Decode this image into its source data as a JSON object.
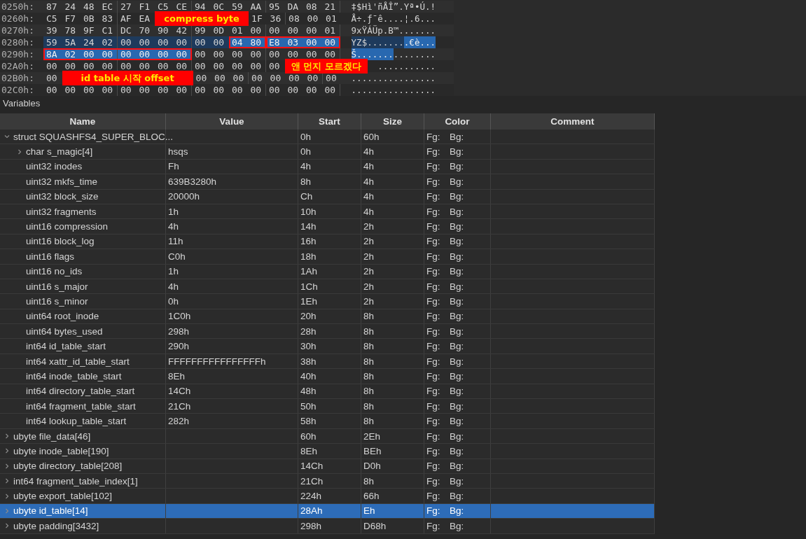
{
  "hex_rows": [
    {
      "address": "0250h:",
      "segments": [
        {
          "kind": "plain",
          "boxed": false,
          "bytes": [
            "87",
            "24",
            "48",
            "EC",
            "27",
            "F1",
            "C5",
            "CE",
            "94",
            "0C",
            "59",
            "AA",
            "95",
            "DA",
            "08",
            "21"
          ]
        }
      ],
      "ascii": [
        {
          "kind": "plain",
          "text": "‡$Hì'ñÅÎ”.Yª•Ú.!"
        }
      ]
    },
    {
      "address": "0260h:",
      "segments": [
        {
          "kind": "plain",
          "boxed": false,
          "bytes": [
            "C5",
            "F7",
            "0B",
            "83",
            "AF",
            "EA"
          ]
        },
        {
          "kind": "callout",
          "text": "compress byte"
        },
        {
          "kind": "plain",
          "boxed": false,
          "bytes": [
            "1F",
            "36",
            "08",
            "00",
            "01"
          ]
        }
      ],
      "ascii": [
        {
          "kind": "plain",
          "text": "Å÷.ƒ¯ê....¦.6..."
        }
      ]
    },
    {
      "address": "0270h:",
      "segments": [
        {
          "kind": "plain",
          "boxed": false,
          "bytes": [
            "39",
            "78",
            "9F",
            "C1",
            "DC",
            "70",
            "90",
            "42",
            "99",
            "0D",
            "01",
            "00",
            "00",
            "00",
            "00",
            "01"
          ]
        }
      ],
      "ascii": [
        {
          "kind": "plain",
          "text": "9xŸÁÜp.B™......."
        }
      ]
    },
    {
      "address": "0280h:",
      "segments": [
        {
          "kind": "dim",
          "boxed": false,
          "bytes": [
            "59",
            "5A",
            "24",
            "02",
            "00",
            "00",
            "00",
            "00",
            "00",
            "00"
          ]
        },
        {
          "kind": "selected",
          "boxed": true,
          "bytes": [
            "04",
            "80"
          ]
        },
        {
          "kind": "selected",
          "boxed": true,
          "bytes": [
            "E8",
            "03",
            "00",
            "00"
          ]
        }
      ],
      "ascii": [
        {
          "kind": "dim",
          "text": "YZ$......."
        },
        {
          "kind": "selected",
          "text": ".€è..."
        }
      ]
    },
    {
      "address": "0290h:",
      "segments": [
        {
          "kind": "selected",
          "boxed": true,
          "bytes": [
            "8A",
            "02",
            "00",
            "00",
            "00",
            "00",
            "00",
            "00"
          ]
        },
        {
          "kind": "plain",
          "boxed": false,
          "bytes": [
            "00",
            "00",
            "00",
            "00",
            "00",
            "00",
            "00",
            "00"
          ]
        }
      ],
      "ascii": [
        {
          "kind": "selected",
          "text": "Š......."
        },
        {
          "kind": "plain",
          "text": "........"
        }
      ]
    },
    {
      "address": "02A0h:",
      "segments": [
        {
          "kind": "plain",
          "boxed": false,
          "bytes": [
            "00",
            "00",
            "00",
            "00",
            "00",
            "00",
            "00",
            "00",
            "00",
            "00",
            "00",
            "00",
            "00"
          ]
        },
        {
          "kind": "callout",
          "text": "앤 먼지 모르겠다"
        }
      ],
      "ascii": [
        {
          "kind": "plain",
          "text": "..........."
        }
      ]
    },
    {
      "address": "02B0h:",
      "segments": [
        {
          "kind": "plain",
          "boxed": false,
          "bytes": [
            "00"
          ]
        },
        {
          "kind": "callout",
          "text": "id table 시작 offset"
        },
        {
          "kind": "plain",
          "boxed": false,
          "bytes": [
            "00",
            "00",
            "00",
            "00",
            "00",
            "00",
            "00",
            "00"
          ]
        }
      ],
      "ascii": [
        {
          "kind": "plain",
          "text": "................"
        }
      ]
    },
    {
      "address": "02C0h:",
      "segments": [
        {
          "kind": "plain",
          "boxed": false,
          "bytes": [
            "00",
            "00",
            "00",
            "00",
            "00",
            "00",
            "00",
            "00",
            "00",
            "00",
            "00",
            "00",
            "00",
            "00",
            "00",
            "00"
          ]
        }
      ],
      "ascii": [
        {
          "kind": "plain",
          "text": "................"
        }
      ]
    }
  ],
  "variables": {
    "title": "Variables",
    "columns": [
      "Name",
      "Value",
      "Start",
      "Size",
      "Color",
      "Comment"
    ],
    "items": [
      {
        "name": "struct SQUASHFS4_SUPER_BLOC...",
        "start": "0h",
        "size": "60h",
        "fg": "Fg:",
        "bg": "Bg:",
        "expanded": true,
        "selected": false,
        "children": [
          {
            "name": "char s_magic[4]",
            "value": "hsqs",
            "start": "0h",
            "size": "4h",
            "fg": "Fg:",
            "bg": "Bg:",
            "expanded": false,
            "selected": false
          },
          {
            "name": "uint32 inodes",
            "value": "Fh",
            "start": "4h",
            "size": "4h",
            "fg": "Fg:",
            "bg": "Bg:",
            "selected": false
          },
          {
            "name": "uint32 mkfs_time",
            "value": "639B3280h",
            "start": "8h",
            "size": "4h",
            "fg": "Fg:",
            "bg": "Bg:",
            "selected": false
          },
          {
            "name": "uint32 block_size",
            "value": "20000h",
            "start": "Ch",
            "size": "4h",
            "fg": "Fg:",
            "bg": "Bg:",
            "selected": false
          },
          {
            "name": "uint32 fragments",
            "value": "1h",
            "start": "10h",
            "size": "4h",
            "fg": "Fg:",
            "bg": "Bg:",
            "selected": false
          },
          {
            "name": "uint16 compression",
            "value": "4h",
            "start": "14h",
            "size": "2h",
            "fg": "Fg:",
            "bg": "Bg:",
            "selected": false
          },
          {
            "name": "uint16 block_log",
            "value": "11h",
            "start": "16h",
            "size": "2h",
            "fg": "Fg:",
            "bg": "Bg:",
            "selected": false
          },
          {
            "name": "uint16 flags",
            "value": "C0h",
            "start": "18h",
            "size": "2h",
            "fg": "Fg:",
            "bg": "Bg:",
            "selected": false
          },
          {
            "name": "uint16 no_ids",
            "value": "1h",
            "start": "1Ah",
            "size": "2h",
            "fg": "Fg:",
            "bg": "Bg:",
            "selected": false
          },
          {
            "name": "uint16 s_major",
            "value": "4h",
            "start": "1Ch",
            "size": "2h",
            "fg": "Fg:",
            "bg": "Bg:",
            "selected": false
          },
          {
            "name": "uint16 s_minor",
            "value": "0h",
            "start": "1Eh",
            "size": "2h",
            "fg": "Fg:",
            "bg": "Bg:",
            "selected": false
          },
          {
            "name": "uint64 root_inode",
            "value": "1C0h",
            "start": "20h",
            "size": "8h",
            "fg": "Fg:",
            "bg": "Bg:",
            "selected": false
          },
          {
            "name": "uint64 bytes_used",
            "value": "298h",
            "start": "28h",
            "size": "8h",
            "fg": "Fg:",
            "bg": "Bg:",
            "selected": false
          },
          {
            "name": "int64 id_table_start",
            "value": "290h",
            "start": "30h",
            "size": "8h",
            "fg": "Fg:",
            "bg": "Bg:",
            "selected": false
          },
          {
            "name": "int64 xattr_id_table_start",
            "value": "FFFFFFFFFFFFFFFFh",
            "start": "38h",
            "size": "8h",
            "fg": "Fg:",
            "bg": "Bg:",
            "selected": false
          },
          {
            "name": "int64 inode_table_start",
            "value": "8Eh",
            "start": "40h",
            "size": "8h",
            "fg": "Fg:",
            "bg": "Bg:",
            "selected": false
          },
          {
            "name": "int64 directory_table_start",
            "value": "14Ch",
            "start": "48h",
            "size": "8h",
            "fg": "Fg:",
            "bg": "Bg:",
            "selected": false
          },
          {
            "name": "int64 fragment_table_start",
            "value": "21Ch",
            "start": "50h",
            "size": "8h",
            "fg": "Fg:",
            "bg": "Bg:",
            "selected": false
          },
          {
            "name": "int64 lookup_table_start",
            "value": "282h",
            "start": "58h",
            "size": "8h",
            "fg": "Fg:",
            "bg": "Bg:",
            "selected": false
          }
        ]
      },
      {
        "name": "ubyte file_data[46]",
        "start": "60h",
        "size": "2Eh",
        "fg": "Fg:",
        "bg": "Bg:",
        "expanded": false,
        "selected": false
      },
      {
        "name": "ubyte inode_table[190]",
        "start": "8Eh",
        "size": "BEh",
        "fg": "Fg:",
        "bg": "Bg:",
        "expanded": false,
        "selected": false
      },
      {
        "name": "ubyte directory_table[208]",
        "start": "14Ch",
        "size": "D0h",
        "fg": "Fg:",
        "bg": "Bg:",
        "expanded": false,
        "selected": false
      },
      {
        "name": "int64 fragment_table_index[1]",
        "start": "21Ch",
        "size": "8h",
        "fg": "Fg:",
        "bg": "Bg:",
        "expanded": false,
        "selected": false
      },
      {
        "name": "ubyte export_table[102]",
        "start": "224h",
        "size": "66h",
        "fg": "Fg:",
        "bg": "Bg:",
        "expanded": false,
        "selected": false
      },
      {
        "name": "ubyte id_table[14]",
        "start": "28Ah",
        "size": "Eh",
        "fg": "Fg:",
        "bg": "Bg:",
        "expanded": false,
        "selected": true
      },
      {
        "name": "ubyte padding[3432]",
        "start": "298h",
        "size": "D68h",
        "fg": "Fg:",
        "bg": "Bg:",
        "expanded": false,
        "selected": false
      }
    ]
  }
}
